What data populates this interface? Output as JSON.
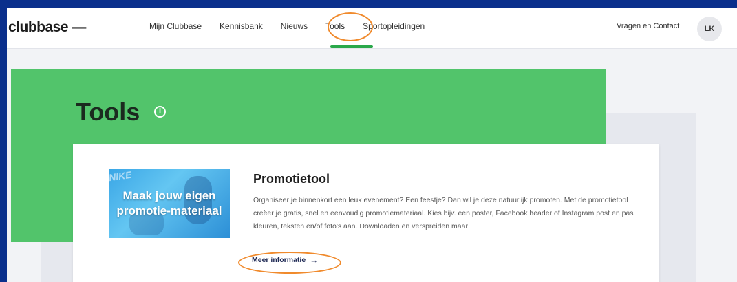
{
  "header": {
    "logo": "clubbase —",
    "nav": [
      {
        "label": "Mijn Clubbase"
      },
      {
        "label": "Kennisbank"
      },
      {
        "label": "Nieuws"
      },
      {
        "label": "Tools"
      },
      {
        "label": "Sportopleidingen"
      }
    ],
    "active_nav": "Tools",
    "contact_label": "Vragen en Contact",
    "avatar_initials": "LK"
  },
  "page": {
    "title": "Tools",
    "info_icon": "info-icon"
  },
  "tool_card": {
    "image_brand": "NIKE",
    "image_text": "Maak jouw eigen promotie-materiaal",
    "title": "Promotietool",
    "description": "Organiseer je binnenkort een leuk evenement? Een feestje? Dan wil je deze natuurlijk promoten. Met de promotietool creëer je gratis, snel en eenvoudig promotiemateriaal. Kies bijv. een poster, Facebook header of Instagram post en pas kleuren, teksten en/of foto's aan. Downloaden en verspreiden maar!",
    "link_label": "Meer informatie",
    "link_icon": "arrow-right-icon"
  },
  "colors": {
    "frame_border": "#0a2f8c",
    "hero_green": "#52c46b",
    "active_underline": "#2aa84a",
    "highlight_oval": "#f08a2c"
  }
}
